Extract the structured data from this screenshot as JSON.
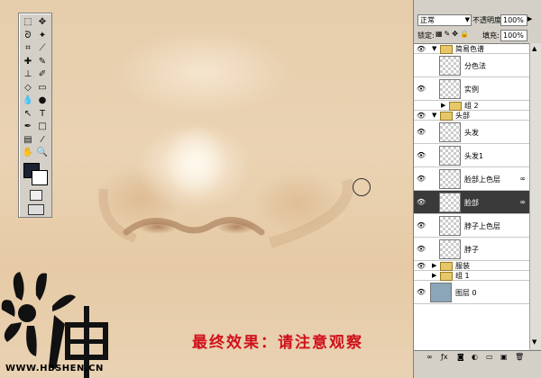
{
  "toolbox": {
    "tools": [
      {
        "name": "marquee-tool-icon",
        "glyph": "⬚"
      },
      {
        "name": "move-tool-icon",
        "glyph": "✥"
      },
      {
        "name": "lasso-tool-icon",
        "glyph": "ᘐ"
      },
      {
        "name": "magic-wand-icon",
        "glyph": "✦"
      },
      {
        "name": "crop-tool-icon",
        "glyph": "⌗"
      },
      {
        "name": "slice-tool-icon",
        "glyph": "⟋"
      },
      {
        "name": "healing-brush-icon",
        "glyph": "✚"
      },
      {
        "name": "brush-tool-icon",
        "glyph": "✎"
      },
      {
        "name": "stamp-tool-icon",
        "glyph": "⊥"
      },
      {
        "name": "history-brush-icon",
        "glyph": "✐"
      },
      {
        "name": "eraser-tool-icon",
        "glyph": "◇"
      },
      {
        "name": "gradient-tool-icon",
        "glyph": "▭"
      },
      {
        "name": "blur-tool-icon",
        "glyph": "💧"
      },
      {
        "name": "dodge-tool-icon",
        "glyph": "●"
      },
      {
        "name": "path-select-icon",
        "glyph": "↖"
      },
      {
        "name": "type-tool-icon",
        "glyph": "T"
      },
      {
        "name": "pen-tool-icon",
        "glyph": "✒"
      },
      {
        "name": "shape-tool-icon",
        "glyph": "□"
      },
      {
        "name": "notes-tool-icon",
        "glyph": "▤"
      },
      {
        "name": "eyedropper-icon",
        "glyph": "⁄"
      },
      {
        "name": "hand-tool-icon",
        "glyph": "✋"
      },
      {
        "name": "zoom-tool-icon",
        "glyph": "🔍"
      }
    ]
  },
  "caption": "最终效果：请注意观察",
  "watermark": {
    "text": "神",
    "site": "WWW.HBSHEN.CN"
  },
  "layers_panel": {
    "blend_mode": "正常",
    "opacity_label": "不透明度:",
    "opacity_value": "100%",
    "lock_label": "锁定:",
    "fill_label": "填充:",
    "fill_value": "100%",
    "layers": [
      {
        "label": "简易色谱",
        "type": "group",
        "visible": true,
        "expanded": true
      },
      {
        "label": "分色法",
        "type": "layer",
        "visible": false
      },
      {
        "label": "实例",
        "type": "layer",
        "visible": true
      },
      {
        "label": "组 2",
        "type": "group",
        "visible": false,
        "expanded": false
      },
      {
        "label": "头部",
        "type": "group",
        "visible": true,
        "expanded": true
      },
      {
        "label": "头发",
        "type": "layer",
        "visible": true
      },
      {
        "label": "头发1",
        "type": "layer",
        "visible": true
      },
      {
        "label": "脸部上色层",
        "type": "layer",
        "visible": true,
        "linked": true
      },
      {
        "label": "脸部",
        "type": "layer",
        "visible": true,
        "selected": true,
        "linked": true
      },
      {
        "label": "脖子上色层",
        "type": "layer",
        "visible": true
      },
      {
        "label": "脖子",
        "type": "layer",
        "visible": true
      },
      {
        "label": "服装",
        "type": "group",
        "visible": true,
        "expanded": false
      },
      {
        "label": "组 1",
        "type": "group",
        "visible": false,
        "expanded": false
      },
      {
        "label": "图层 0",
        "type": "layer",
        "visible": true,
        "blue": true
      }
    ]
  }
}
